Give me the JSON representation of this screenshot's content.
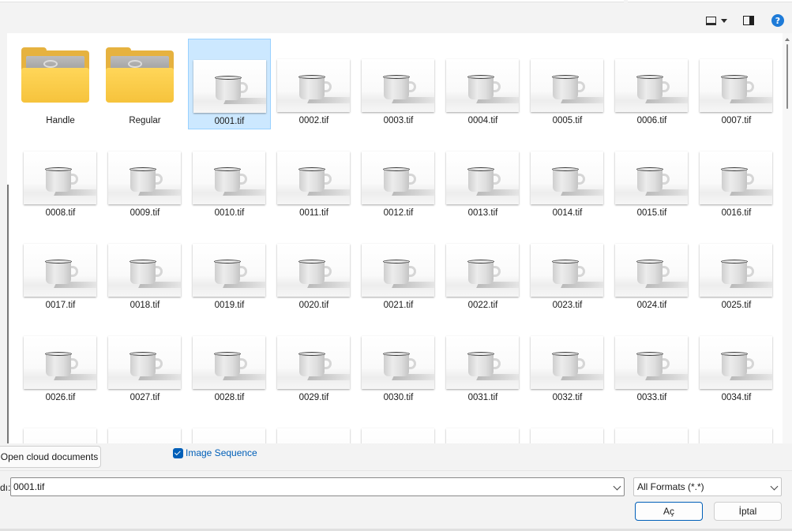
{
  "toolbar": {
    "view_icon": "monitor-icon",
    "dropdown_icon": "caret-down-icon",
    "preview_icon": "preview-pane-icon",
    "help_label": "?"
  },
  "files": [
    {
      "name": "Handle",
      "kind": "folder"
    },
    {
      "name": "Regular",
      "kind": "folder"
    },
    {
      "name": "0001.tif",
      "kind": "image",
      "selected": true
    },
    {
      "name": "0002.tif",
      "kind": "image"
    },
    {
      "name": "0003.tif",
      "kind": "image"
    },
    {
      "name": "0004.tif",
      "kind": "image"
    },
    {
      "name": "0005.tif",
      "kind": "image"
    },
    {
      "name": "0006.tif",
      "kind": "image"
    },
    {
      "name": "0007.tif",
      "kind": "image"
    },
    {
      "name": "0008.tif",
      "kind": "image"
    },
    {
      "name": "0009.tif",
      "kind": "image"
    },
    {
      "name": "0010.tif",
      "kind": "image"
    },
    {
      "name": "0011.tif",
      "kind": "image"
    },
    {
      "name": "0012.tif",
      "kind": "image"
    },
    {
      "name": "0013.tif",
      "kind": "image"
    },
    {
      "name": "0014.tif",
      "kind": "image"
    },
    {
      "name": "0015.tif",
      "kind": "image"
    },
    {
      "name": "0016.tif",
      "kind": "image"
    },
    {
      "name": "0017.tif",
      "kind": "image"
    },
    {
      "name": "0018.tif",
      "kind": "image"
    },
    {
      "name": "0019.tif",
      "kind": "image"
    },
    {
      "name": "0020.tif",
      "kind": "image"
    },
    {
      "name": "0021.tif",
      "kind": "image"
    },
    {
      "name": "0022.tif",
      "kind": "image"
    },
    {
      "name": "0023.tif",
      "kind": "image"
    },
    {
      "name": "0024.tif",
      "kind": "image"
    },
    {
      "name": "0025.tif",
      "kind": "image"
    },
    {
      "name": "0026.tif",
      "kind": "image"
    },
    {
      "name": "0027.tif",
      "kind": "image"
    },
    {
      "name": "0028.tif",
      "kind": "image"
    },
    {
      "name": "0029.tif",
      "kind": "image"
    },
    {
      "name": "0030.tif",
      "kind": "image"
    },
    {
      "name": "0031.tif",
      "kind": "image"
    },
    {
      "name": "0032.tif",
      "kind": "image"
    },
    {
      "name": "0033.tif",
      "kind": "image"
    },
    {
      "name": "0034.tif",
      "kind": "image"
    },
    {
      "name": "",
      "kind": "image"
    },
    {
      "name": "",
      "kind": "image"
    },
    {
      "name": "",
      "kind": "image"
    },
    {
      "name": "",
      "kind": "image"
    },
    {
      "name": "",
      "kind": "image"
    },
    {
      "name": "",
      "kind": "image"
    },
    {
      "name": "",
      "kind": "image"
    },
    {
      "name": "",
      "kind": "image"
    },
    {
      "name": "",
      "kind": "image"
    }
  ],
  "footer": {
    "cloud_button": "Open cloud documents",
    "image_sequence_label": "Image Sequence",
    "image_sequence_checked": true,
    "filename_label": "dı:",
    "filename_value": "0001.tif",
    "format_value": "All Formats (*.*)",
    "open_button": "Aç",
    "cancel_button": "İptal"
  },
  "colors": {
    "accent": "#005fb8",
    "selection_bg": "#cce8ff",
    "selection_border": "#99d1ff",
    "folder": "#f6c33c",
    "help_icon": "#1e7bd8"
  }
}
